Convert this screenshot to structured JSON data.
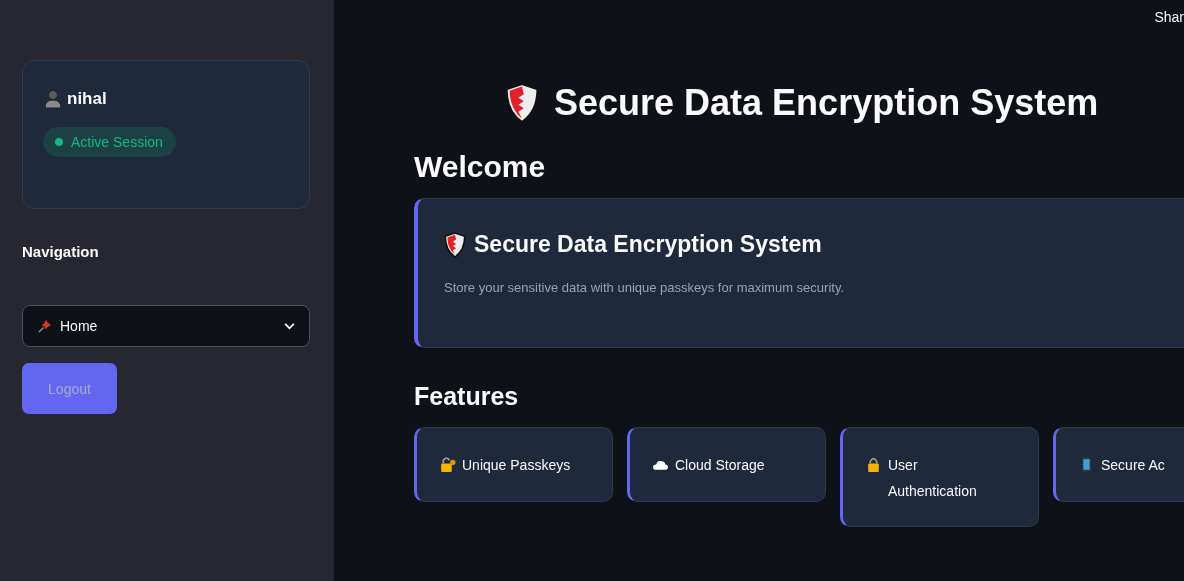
{
  "sidebar": {
    "user": {
      "name": "nihal"
    },
    "session_badge": "Active Session",
    "navigation_label": "Navigation",
    "page_select": {
      "value": "Home"
    },
    "logout_button": "Logout"
  },
  "header": {
    "share": "Shar"
  },
  "title": "Secure Data Encryption System",
  "welcome_heading": "Welcome",
  "hero_card": {
    "title": "Secure Data Encryption System",
    "text": "Store your sensitive data with unique passkeys for maximum security."
  },
  "features_heading": "Features",
  "features": [
    {
      "kind": "keylock",
      "label": "Unique Passkeys"
    },
    {
      "kind": "cloud",
      "label": "Cloud Storage"
    },
    {
      "kind": "lock",
      "label": "User Authentication"
    },
    {
      "kind": "phone",
      "label": "Secure Ac"
    }
  ]
}
